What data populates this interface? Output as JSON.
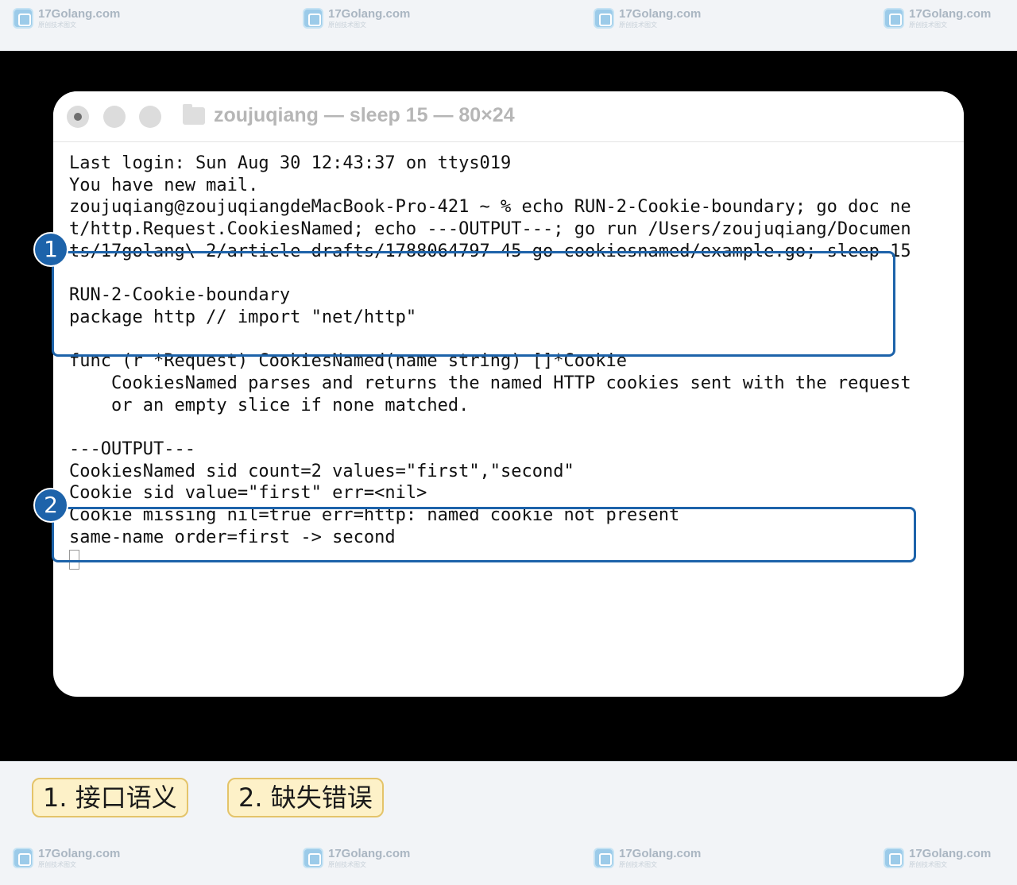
{
  "watermark": {
    "text": "17Golang.com",
    "subtext": "原创技术图文"
  },
  "window": {
    "title": "zoujuqiang — sleep 15 — 80×24",
    "buttons": {
      "close": "close",
      "minimize": "minimize",
      "zoom": "zoom"
    }
  },
  "terminal": {
    "lines": [
      "Last login: Sun Aug 30 12:43:37 on ttys019",
      "You have new mail.",
      "zoujuqiang@zoujuqiangdeMacBook-Pro-421 ~ % echo RUN-2-Cookie-boundary; go doc ne",
      "t/http.Request.CookiesNamed; echo ---OUTPUT---; go run /Users/zoujuqiang/Documen",
      "ts/17golang\\ 2/article-drafts/1788064797-45-go-cookiesnamed/example.go; sleep 15",
      "",
      "RUN-2-Cookie-boundary",
      "package http // import \"net/http\"",
      "",
      "func (r *Request) CookiesNamed(name string) []*Cookie",
      "    CookiesNamed parses and returns the named HTTP cookies sent with the request",
      "    or an empty slice if none matched.",
      "",
      "---OUTPUT---",
      "CookiesNamed sid count=2 values=\"first\",\"second\"",
      "Cookie sid value=\"first\" err=<nil>",
      "Cookie missing nil=true err=http: named cookie not present",
      "same-name order=first -> second"
    ]
  },
  "annotations": {
    "badge1": "1",
    "badge2": "2",
    "legend": [
      "1. 接口语义",
      "2. 缺失错误"
    ]
  },
  "colors": {
    "annotation_blue": "#1d63aa",
    "legend_fill": "#fdf1c8",
    "legend_border": "#e4c46a",
    "terminal_bg": "#ffffff",
    "stage_bg": "#000000"
  }
}
